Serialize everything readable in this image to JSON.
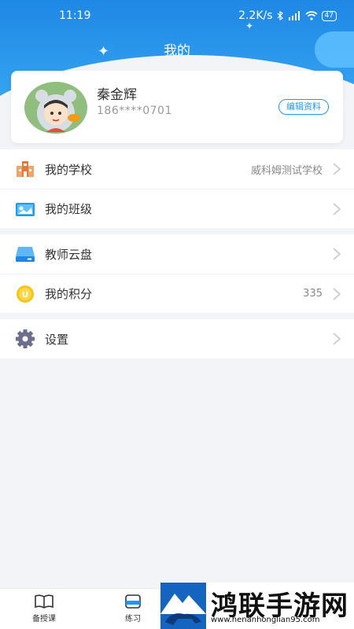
{
  "status_bar": {
    "time": "11:19",
    "network_speed": "2.2K/s",
    "battery": "47"
  },
  "header": {
    "title": "我的"
  },
  "profile": {
    "name": "秦金辉",
    "phone": "186****0701",
    "edit_label": "编辑资料"
  },
  "menu_groups": [
    [
      {
        "label": "我的学校",
        "value": "威科姆测试学校",
        "icon": "school-building-icon",
        "color": "#e07b3c"
      },
      {
        "label": "我的班级",
        "value": "",
        "icon": "class-board-icon",
        "color": "#2196f3"
      }
    ],
    [
      {
        "label": "教师云盘",
        "value": "",
        "icon": "cloud-drive-icon",
        "color": "#2196f3"
      },
      {
        "label": "我的积分",
        "value": "335",
        "icon": "points-coin-icon",
        "color": "#f5c518"
      }
    ],
    [
      {
        "label": "设置",
        "value": "",
        "icon": "gear-icon",
        "color": "#6b6f8a"
      }
    ]
  ],
  "tabbar": {
    "tabs": [
      {
        "label": "备授课",
        "icon": "open-book-icon"
      },
      {
        "label": "练习",
        "icon": "practice-icon"
      }
    ]
  },
  "watermark": {
    "name": "鸿联手游网",
    "url": "www.henanhonglian95.com"
  }
}
